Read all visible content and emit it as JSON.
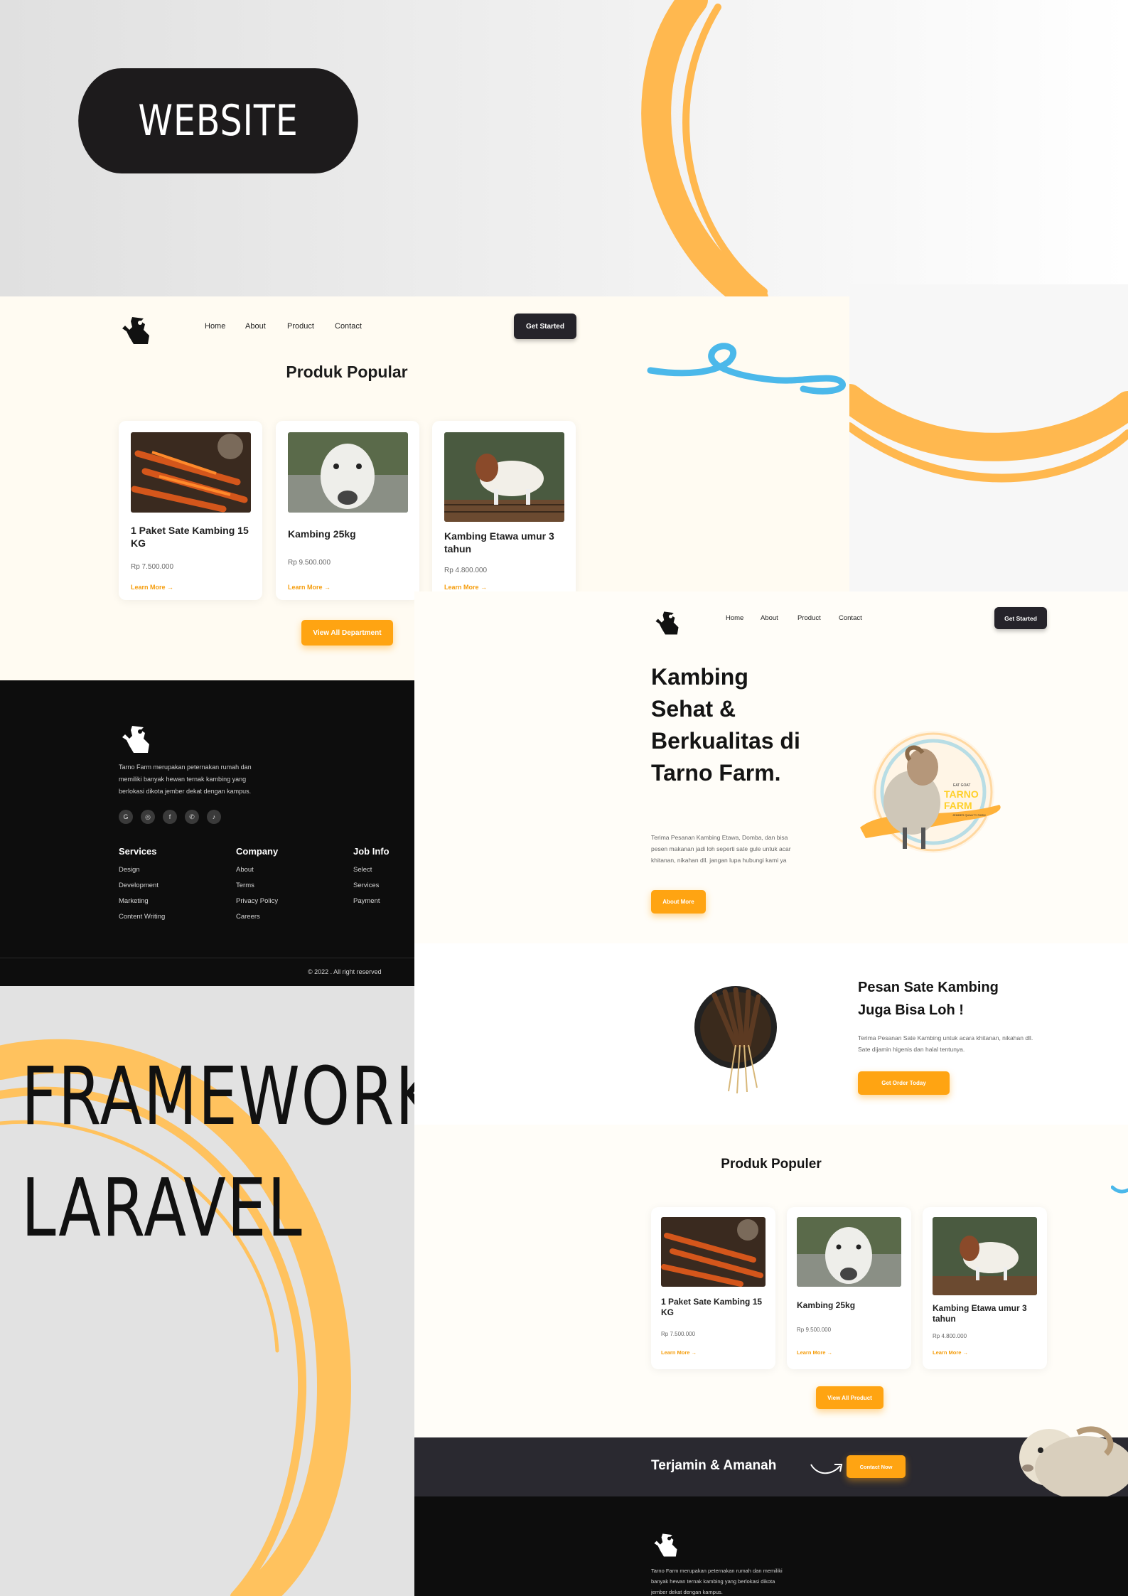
{
  "labels": {
    "website": "WEBSITE",
    "framework": "FRAMEWORK",
    "laravel": "LARAVEL"
  },
  "colors": {
    "accent": "#ffa412",
    "dark": "#1d1b1c",
    "cream": "#fffbf2",
    "footer": "#0d0d0d",
    "squiggle": "#4bb8ea"
  },
  "nav": {
    "home": "Home",
    "about": "About",
    "product": "Product",
    "contact": "Contact",
    "cta": "Get Started"
  },
  "products": [
    {
      "name": "1 Paket Sate Kambing 15 KG",
      "price": "Rp 7.500.000",
      "link": "Learn More"
    },
    {
      "name": "Kambing 25kg",
      "price": "Rp 9.500.000",
      "link": "Learn More"
    },
    {
      "name": "Kambing Etawa umur 3 tahun",
      "price": "Rp 4.800.000",
      "link": "Learn More"
    }
  ],
  "page1": {
    "heading": "Produk Popular",
    "button": "View All Department"
  },
  "footer": {
    "description": "Tarno Farm merupakan peternakan rumah dan memiliki banyak hewan ternak kambing yang berlokasi dikota jember dekat dengan kampus.",
    "social": [
      "google-icon",
      "instagram-icon",
      "facebook-icon",
      "whatsapp-icon",
      "tiktok-icon"
    ],
    "col1": {
      "title": "Services",
      "links": [
        "Design",
        "Development",
        "Marketing",
        "Content Writing"
      ]
    },
    "col2": {
      "title": "Company",
      "links": [
        "About",
        "Terms",
        "Privacy Policy",
        "Careers"
      ]
    },
    "col3": {
      "title": "Job Info",
      "links": [
        "Select",
        "Services",
        "Payment"
      ]
    },
    "copyright": "© 2022 . All right reserved"
  },
  "hero": {
    "title": "Kambing Sehat & Berkualitas di Tarno Farm.",
    "description": "Terima Pesanan Kambing Etawa, Domba, dan bisa pesen makanan jadi loh seperti sate gule untuk acar khitanan, nikahan dll. jangan lupa hubungi kami ya",
    "button": "About More",
    "badge": {
      "small": "EAT GOAT",
      "brand": "TARNO FARM",
      "sub": "JEMBER QUALITY FARM"
    }
  },
  "sate": {
    "title": "Pesan Sate Kambing Juga Bisa Loh !",
    "description": "Terima Pesanan Sate Kambing untuk acara khitanan, nikahan dll. Sate dijamin higenis dan halal tentunya.",
    "button": "Get Order Today"
  },
  "page2": {
    "heading": "Produk Populer",
    "button": "View All Product"
  },
  "banner": {
    "text": "Terjamin & Amanah",
    "button": "Contact Now"
  }
}
